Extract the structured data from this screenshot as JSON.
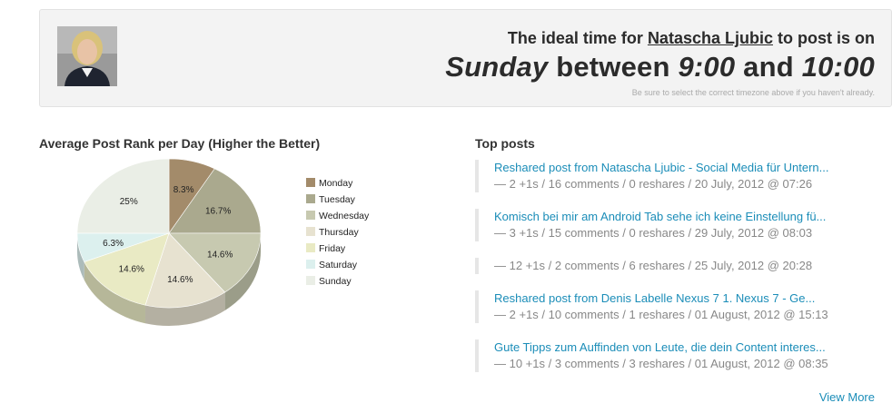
{
  "header": {
    "line_prefix": "The ideal time for",
    "user_name": "Natascha Ljubic",
    "line_suffix": "to post is on",
    "day": "Sunday",
    "between": "between",
    "start_time": "9:00",
    "and": "and",
    "end_time": "10:00",
    "note": "Be sure to select the correct timezone above if you haven't already."
  },
  "chart_section": {
    "title": "Average Post Rank per Day (Higher the Better)"
  },
  "chart_data": {
    "type": "pie",
    "title": "Average Post Rank per Day (Higher the Better)",
    "slices": [
      {
        "label": "Monday",
        "value": 8.3,
        "display": "8.3%",
        "color": "#a38b6a"
      },
      {
        "label": "Tuesday",
        "value": 16.7,
        "display": "16.7%",
        "color": "#aaa98e"
      },
      {
        "label": "Wednesday",
        "value": 14.6,
        "display": "14.6%",
        "color": "#c7c9b0"
      },
      {
        "label": "Thursday",
        "value": 14.6,
        "display": "14.6%",
        "color": "#e7e2d0"
      },
      {
        "label": "Friday",
        "value": 14.6,
        "display": "14.6%",
        "color": "#e9eac4"
      },
      {
        "label": "Saturday",
        "value": 6.3,
        "display": "6.3%",
        "color": "#dcf0ee"
      },
      {
        "label": "Sunday",
        "value": 25,
        "display": "25%",
        "color": "#eaeee6"
      }
    ],
    "legend_position": "right"
  },
  "top_posts": {
    "title": "Top posts",
    "items": [
      {
        "link": "Reshared post from Natascha Ljubic - Social Media für Untern...",
        "meta": "— 2 +1s / 16 comments / 0 reshares / 20 July, 2012 @ 07:26"
      },
      {
        "link": "Komisch bei mir am Android Tab sehe ich keine Einstellung fü...",
        "meta": "— 3 +1s / 15 comments / 0 reshares / 29 July, 2012 @ 08:03"
      },
      {
        "link": "",
        "meta": "— 12 +1s / 2 comments / 6 reshares / 25 July, 2012 @ 20:28"
      },
      {
        "link": "Reshared post from Denis Labelle Nexus 7 1. Nexus 7 - Ge...",
        "meta": "— 2 +1s / 10 comments / 1 reshares / 01 August, 2012 @ 15:13"
      },
      {
        "link": "Gute Tipps zum Auffinden von Leute, die dein Content interes...",
        "meta": "— 10 +1s / 3 comments / 3 reshares / 01 August, 2012 @ 08:35"
      }
    ],
    "view_more": "View More"
  }
}
